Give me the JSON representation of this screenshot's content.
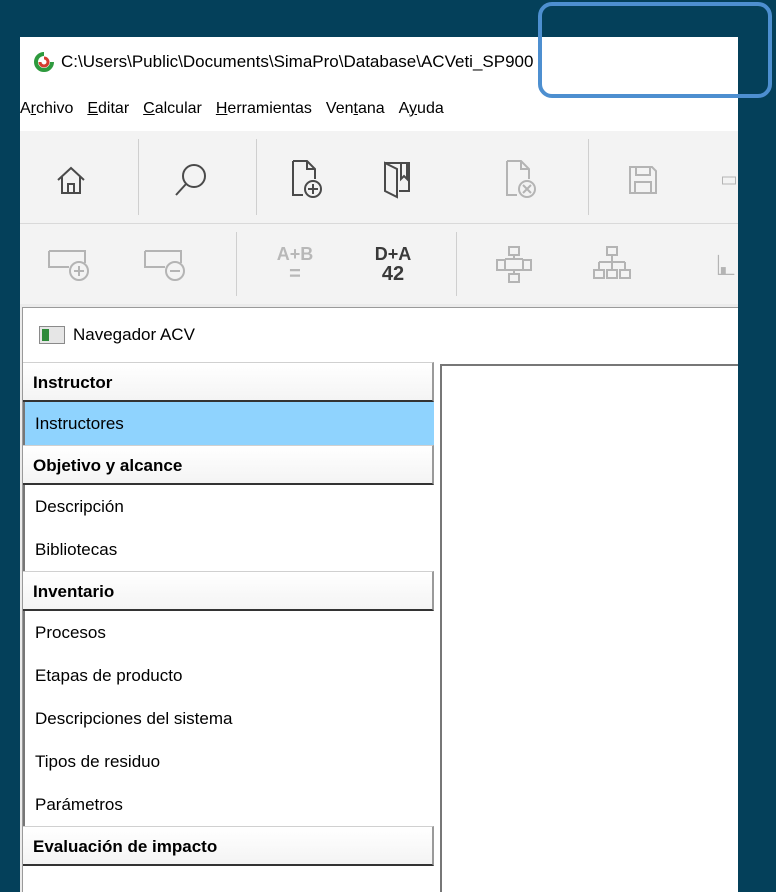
{
  "window": {
    "title": "C:\\Users\\Public\\Documents\\SimaPro\\Database\\ACVeti_SP900"
  },
  "menu": [
    {
      "pre": "A",
      "key": "r",
      "post": "chivo"
    },
    {
      "pre": "",
      "key": "E",
      "post": "ditar"
    },
    {
      "pre": "",
      "key": "C",
      "post": "alcular"
    },
    {
      "pre": "",
      "key": "H",
      "post": "erramientas"
    },
    {
      "pre": "Ven",
      "key": "t",
      "post": "ana"
    },
    {
      "pre": "A",
      "key": "y",
      "post": "uda"
    }
  ],
  "toolbar1": {
    "icons": [
      "home-icon",
      "search-icon",
      "new-document-icon",
      "open-book-icon",
      "close-document-icon",
      "save-icon"
    ]
  },
  "toolbar2": {
    "icons": [
      "add-item-icon",
      "remove-item-icon",
      "compare-icon",
      "analyze-icon",
      "network-icon",
      "tree-icon"
    ],
    "compare": {
      "line1": "A+B",
      "line2": "="
    },
    "analyze": {
      "line1": "D+A",
      "line2": "42"
    }
  },
  "navigator": {
    "title": "Navegador ACV",
    "sections": [
      {
        "header": "Instructor",
        "items": [
          "Instructores"
        ]
      },
      {
        "header": "Objetivo y alcance",
        "items": [
          "Descripción",
          "Bibliotecas"
        ]
      },
      {
        "header": "Inventario",
        "items": [
          "Procesos",
          "Etapas de producto",
          "Descripciones del sistema",
          "Tipos de residuo",
          "Parámetros"
        ]
      },
      {
        "header": "Evaluación de impacto",
        "items": []
      }
    ],
    "selected_item": "Instructores"
  },
  "colors": {
    "background": "#04405a",
    "selection": "#8fd3fe",
    "highlight_box": "#4d8fd0"
  }
}
